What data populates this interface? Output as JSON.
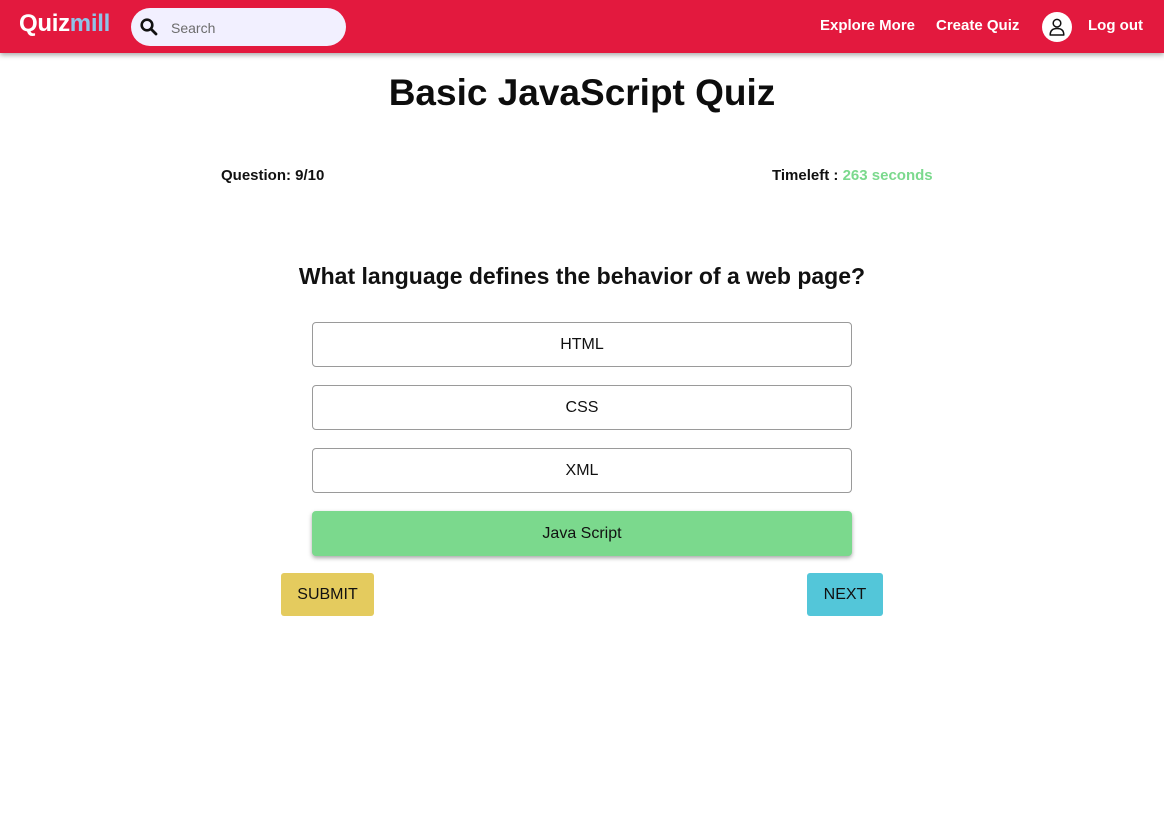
{
  "navbar": {
    "brand_part1": "Quiz",
    "brand_part2": "mill",
    "search_placeholder": "Search",
    "explore_label": "Explore More",
    "create_label": "Create Quiz",
    "logout_label": "Log out",
    "colors": {
      "bar": "#e3193e",
      "brand_accent": "#8fc3e8",
      "search_bg": "#f2f0ff"
    },
    "icons": [
      "search-icon",
      "user-icon"
    ]
  },
  "quiz": {
    "title": "Basic JavaScript Quiz",
    "question_label": "Question: 9/10",
    "time_label": "Timeleft :",
    "time_value": "263 seconds",
    "question_text": "What language defines the behavior of a web page?",
    "options": [
      "HTML",
      "CSS",
      "XML",
      "Java Script"
    ],
    "selected_option": "Java Script",
    "colors": {
      "selected": "#7bd98d",
      "submit": "#e4cb5e",
      "next": "#53c6d9",
      "time": "#7bd98d"
    }
  },
  "actions": {
    "submit_label": "SUBMIT",
    "next_label": "NEXT"
  }
}
